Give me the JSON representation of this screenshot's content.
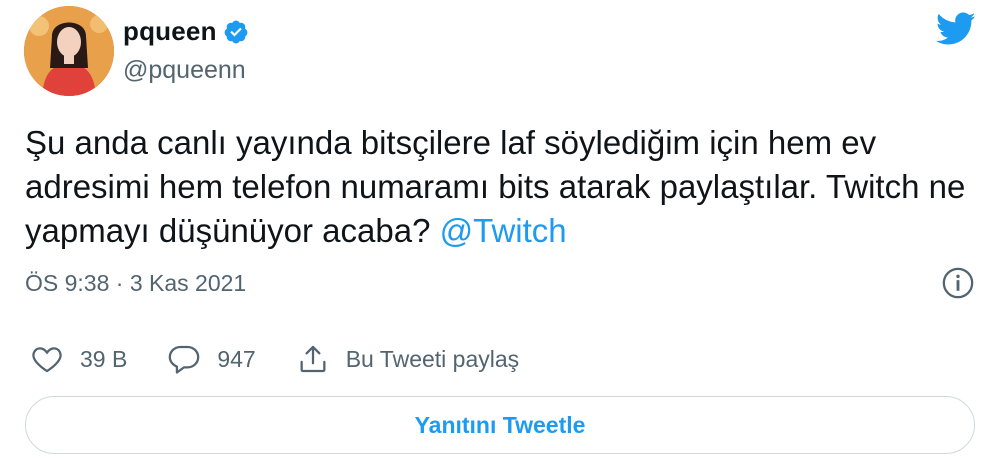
{
  "user": {
    "display_name": "pqueen",
    "handle": "@pqueenn",
    "verified": true
  },
  "tweet": {
    "text_before": "Şu anda canlı yayında bitsçilere laf söylediğim için hem ev adresimi hem telefon numaramı bits atarak paylaştılar. Twitch ne yapmayı düşünüyor acaba? ",
    "mention": "@Twitch",
    "time": "ÖS 9:38",
    "separator": "·",
    "date": "3 Kas 2021"
  },
  "actions": {
    "like_count": "39 B",
    "reply_count": "947",
    "share_label": "Bu Tweeti paylaş"
  },
  "reply_button_label": "Yanıtını Tweetle",
  "colors": {
    "brand": "#1d9bf0",
    "secondary_text": "#536471",
    "border": "#cfd9de"
  },
  "icons": [
    "verified-badge-icon",
    "twitter-bird-icon",
    "info-icon",
    "heart-icon",
    "reply-bubble-icon",
    "share-icon"
  ]
}
